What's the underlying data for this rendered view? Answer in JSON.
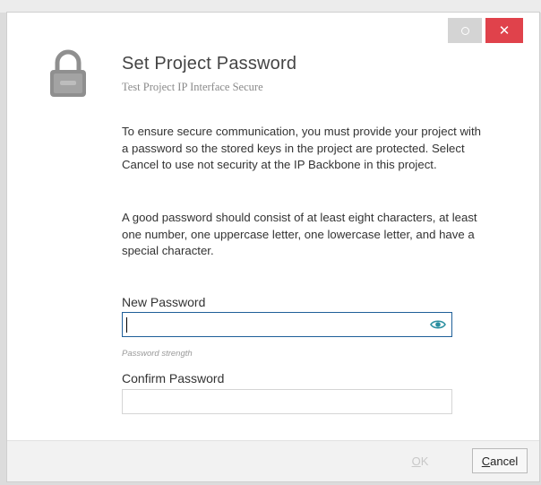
{
  "titlebar": {
    "close_glyph": "✕"
  },
  "dialog": {
    "title": "Set Project Password",
    "subtitle": "Test Project IP Interface Secure",
    "paragraph1": "To ensure secure communication, you must provide your project with a password so the stored keys in the project are protected. Select Cancel to use not security at the IP Backbone in this project.",
    "paragraph2": "A good password should consist of at least eight characters, at least one number, one uppercase letter, one lowercase letter, and have a special character."
  },
  "new_password": {
    "label": "New Password",
    "value": "",
    "strength_hint": "Password strength"
  },
  "confirm_password": {
    "label": "Confirm Password",
    "value": ""
  },
  "buttons": {
    "ok_mnemonic": "O",
    "ok_rest": "K",
    "cancel_mnemonic": "C",
    "cancel_rest": "ancel"
  },
  "icons": {
    "header": "lock-icon",
    "reveal": "eye-icon"
  },
  "colors": {
    "close_button": "#e0424b",
    "focus_border": "#1f5f99",
    "eye": "#2a8fa0"
  }
}
